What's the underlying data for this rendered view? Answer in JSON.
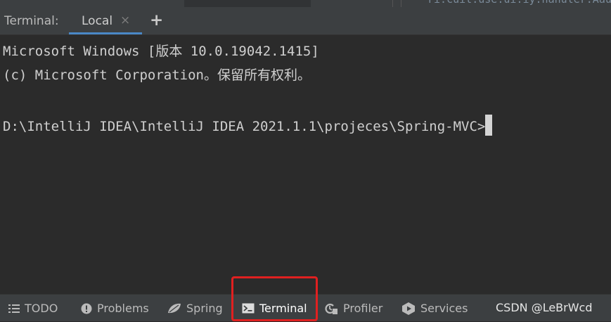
{
  "top_peek_text": "ri.cuil.use.ui.iy.nanuler.Aaupu",
  "terminal_panel": {
    "title": "Terminal:",
    "tab_label": "Local",
    "close_glyph": "×",
    "add_glyph": "+"
  },
  "terminal_output": {
    "line1": "Microsoft Windows [版本 10.0.19042.1415]",
    "line2": "(c) Microsoft Corporation。保留所有权利。",
    "prompt": "D:\\IntelliJ IDEA\\IntelliJ IDEA 2021.1.1\\projeces\\Spring-MVC>"
  },
  "tool_windows": [
    {
      "label": "TODO",
      "icon": "list-icon"
    },
    {
      "label": "Problems",
      "icon": "warning-icon"
    },
    {
      "label": "Spring",
      "icon": "spring-leaf-icon"
    },
    {
      "label": "Terminal",
      "icon": "terminal-icon"
    },
    {
      "label": "Profiler",
      "icon": "profiler-icon"
    },
    {
      "label": "Services",
      "icon": "services-icon"
    }
  ],
  "watermark": "CSDN @LeBrWcd",
  "colors": {
    "background": "#2b2b2b",
    "panel": "#3c3f41",
    "tab_underline": "#4a88c7",
    "highlight_box": "#e02020"
  }
}
